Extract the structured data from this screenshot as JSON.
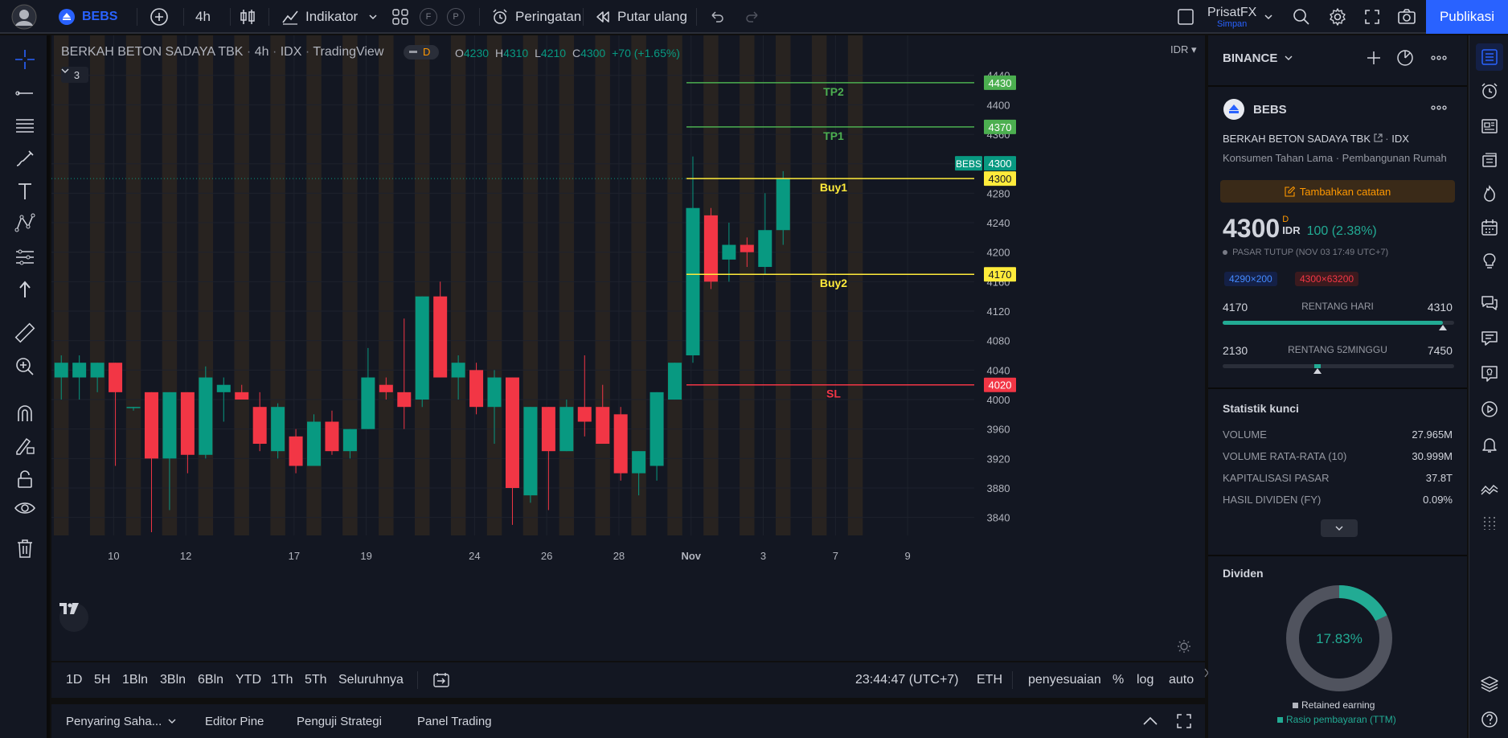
{
  "topbar": {
    "symbol": "BEBS",
    "interval": "4h",
    "indicators_label": "Indikator",
    "alerts_label": "Peringatan",
    "replay_label": "Putar ulang",
    "layout_name": "PrisatFX",
    "layout_status": "Simpan",
    "publish_label": "Publikasi",
    "f_label": "F",
    "p_label": "P"
  },
  "legend": {
    "name": "BERKAH BETON SADAYA TBK",
    "interval": "4h",
    "exchange": "IDX",
    "source": "TradingView",
    "badge": "D",
    "o_label": "O",
    "o": "4230",
    "h_label": "H",
    "h": "4310",
    "l_label": "L",
    "l": "4210",
    "c_label": "C",
    "c": "4300",
    "change": "+70 (+1.65%)",
    "collapse_count": "3",
    "currency": "IDR"
  },
  "chart_data": {
    "type": "candlestick",
    "y_ticks": [
      4440,
      4400,
      4360,
      4320,
      4280,
      4240,
      4200,
      4160,
      4120,
      4080,
      4040,
      4000,
      3960,
      3920,
      3880,
      3840
    ],
    "ylim": [
      3820,
      4455
    ],
    "x_ticks": [
      "10",
      "12",
      "17",
      "19",
      "24",
      "26",
      "28",
      "Nov",
      "3",
      "7",
      "9"
    ],
    "x_tick_slots": [
      2.9,
      6.9,
      12.9,
      16.9,
      22.9,
      26.9,
      30.9,
      34.9,
      38.9,
      42.9,
      46.9
    ],
    "candles": [
      {
        "o": 4030,
        "h": 4060,
        "l": 4000,
        "c": 4050
      },
      {
        "o": 4030,
        "h": 4060,
        "l": 4000,
        "c": 4050
      },
      {
        "o": 4030,
        "h": 4050,
        "l": 4010,
        "c": 4050
      },
      {
        "o": 4050,
        "h": 4050,
        "l": 3910,
        "c": 4010
      },
      {
        "o": 3990,
        "h": 3990,
        "l": 3985,
        "c": 3990
      },
      {
        "o": 4010,
        "h": 4010,
        "l": 3820,
        "c": 3920
      },
      {
        "o": 3920,
        "h": 4010,
        "l": 3850,
        "c": 4010
      },
      {
        "o": 4010,
        "h": 4010,
        "l": 3900,
        "c": 3925
      },
      {
        "o": 3925,
        "h": 4045,
        "l": 3920,
        "c": 4030
      },
      {
        "o": 4010,
        "h": 4030,
        "l": 3970,
        "c": 4020
      },
      {
        "o": 4010,
        "h": 4020,
        "l": 4000,
        "c": 4000
      },
      {
        "o": 3990,
        "h": 4010,
        "l": 3930,
        "c": 3940
      },
      {
        "o": 3930,
        "h": 3995,
        "l": 3920,
        "c": 3990
      },
      {
        "o": 3950,
        "h": 3960,
        "l": 3900,
        "c": 3910
      },
      {
        "o": 3910,
        "h": 3980,
        "l": 3910,
        "c": 3970
      },
      {
        "o": 3970,
        "h": 3985,
        "l": 3925,
        "c": 3930
      },
      {
        "o": 3930,
        "h": 3960,
        "l": 3920,
        "c": 3960
      },
      {
        "o": 3960,
        "h": 4070,
        "l": 3960,
        "c": 4030
      },
      {
        "o": 4020,
        "h": 4030,
        "l": 4000,
        "c": 4010
      },
      {
        "o": 4010,
        "h": 4110,
        "l": 3960,
        "c": 3990
      },
      {
        "o": 4000,
        "h": 4140,
        "l": 3990,
        "c": 4140
      },
      {
        "o": 4140,
        "h": 4160,
        "l": 4030,
        "c": 4030
      },
      {
        "o": 4030,
        "h": 4060,
        "l": 4000,
        "c": 4050
      },
      {
        "o": 4040,
        "h": 4050,
        "l": 3980,
        "c": 3990
      },
      {
        "o": 3990,
        "h": 4040,
        "l": 3940,
        "c": 4030
      },
      {
        "o": 4030,
        "h": 4030,
        "l": 3830,
        "c": 3880
      },
      {
        "o": 3870,
        "h": 3990,
        "l": 3860,
        "c": 3990
      },
      {
        "o": 3990,
        "h": 3990,
        "l": 3850,
        "c": 3930
      },
      {
        "o": 3930,
        "h": 4000,
        "l": 3930,
        "c": 3990
      },
      {
        "o": 3990,
        "h": 4060,
        "l": 3950,
        "c": 3970
      },
      {
        "o": 3990,
        "h": 4020,
        "l": 3950,
        "c": 3940
      },
      {
        "o": 3980,
        "h": 3990,
        "l": 3890,
        "c": 3900
      },
      {
        "o": 3900,
        "h": 3930,
        "l": 3870,
        "c": 3930
      },
      {
        "o": 3910,
        "h": 4010,
        "l": 3890,
        "c": 4010
      },
      {
        "o": 4000,
        "h": 4050,
        "l": 4000,
        "c": 4050
      },
      {
        "o": 4060,
        "h": 4330,
        "l": 4050,
        "c": 4260
      },
      {
        "o": 4250,
        "h": 4260,
        "l": 4150,
        "c": 4160
      },
      {
        "o": 4190,
        "h": 4240,
        "l": 4160,
        "c": 4210
      },
      {
        "o": 4210,
        "h": 4220,
        "l": 4180,
        "c": 4200
      },
      {
        "o": 4180,
        "h": 4280,
        "l": 4170,
        "c": 4230
      },
      {
        "o": 4230,
        "h": 4310,
        "l": 4210,
        "c": 4300
      }
    ],
    "hlines": [
      {
        "label": "TP2",
        "value": 4430,
        "color": "#4caf50"
      },
      {
        "label": "TP1",
        "value": 4370,
        "color": "#4caf50"
      },
      {
        "label": "Buy1",
        "value": 4300,
        "color": "#ffeb3b"
      },
      {
        "label": "Buy2",
        "value": 4170,
        "color": "#ffeb3b"
      },
      {
        "label": "SL",
        "value": 4020,
        "color": "#f23645"
      }
    ],
    "price_tags": [
      {
        "text": "4430",
        "value": 4430,
        "bg": "#4caf50",
        "fg": "#ffffff"
      },
      {
        "text": "4370",
        "value": 4370,
        "bg": "#4caf50",
        "fg": "#ffffff"
      },
      {
        "text": "4300",
        "value": 4300,
        "bg": "#ffeb3b",
        "fg": "#131722"
      },
      {
        "text": "4170",
        "value": 4170,
        "bg": "#ffeb3b",
        "fg": "#131722"
      },
      {
        "text": "4020",
        "value": 4020,
        "bg": "#f23645",
        "fg": "#ffffff"
      }
    ],
    "last_price": {
      "symbol": "BEBS",
      "value": 4300,
      "text": "4300"
    },
    "up_color": "#089981",
    "down_color": "#f23645",
    "session_band_color": "#3a2e1f"
  },
  "timeframes": [
    "1D",
    "5H",
    "1Bln",
    "3Bln",
    "6Bln",
    "YTD",
    "1Th",
    "5Th",
    "Seluruhnya"
  ],
  "status": {
    "clock": "23:44:47 (UTC+7)",
    "session": "ETH",
    "adjust": "penyesuaian",
    "percent": "%",
    "log": "log",
    "auto": "auto"
  },
  "bottom_tabs": [
    "Penyaring Saha...",
    "Editor Pine",
    "Penguji Strategi",
    "Panel Trading"
  ],
  "watchlist": {
    "exchange": "BINANCE",
    "symbol": "BEBS",
    "company": "BERKAH BETON SADAYA TBK",
    "exchange_short": "IDX",
    "sector": "Konsumen Tahan Lama",
    "industry": "Pembangunan Rumah",
    "note_button": "Tambahkan catatan",
    "price": "4300",
    "price_sup": "D",
    "currency": "IDR",
    "change": "100 (2.38%)",
    "market_status": "PASAR TUTUP",
    "market_time": "(NOV 03 17:49 UTC+7)",
    "bid": "4290×200",
    "ask": "4300×63200",
    "day_low": "4170",
    "day_high": "4310",
    "day_range_label": "RENTANG HARI",
    "day_fill": 0.95,
    "wk_low": "2130",
    "wk_high": "7450",
    "wk_range_label": "RENTANG 52MINGGU",
    "wk_fill": 0.41,
    "stats_title": "Statistik kunci",
    "stats": [
      {
        "label": "VOLUME",
        "value": "27.965M"
      },
      {
        "label": "VOLUME RATA-RATA (10)",
        "value": "30.999M"
      },
      {
        "label": "KAPITALISASI PASAR",
        "value": "37.8T"
      },
      {
        "label": "HASIL DIVIDEN (FY)",
        "value": "0.09%"
      }
    ],
    "dividend_title": "Dividen",
    "dividend_percent": "17.83%",
    "dividend_share": 0.1783,
    "legend_retained": "Retained earning",
    "legend_payout": "Rasio pembayaran (TTM)"
  }
}
